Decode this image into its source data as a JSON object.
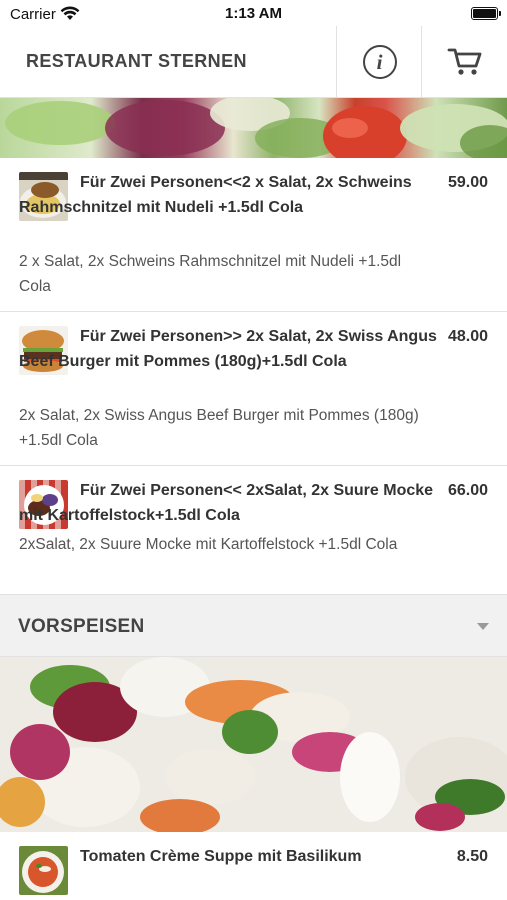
{
  "status_bar": {
    "carrier": "Carrier",
    "time": "1:13 AM"
  },
  "header": {
    "title": "RESTAURANT STERNEN",
    "info_icon": "info-circle-icon",
    "cart_icon": "shopping-cart-icon"
  },
  "items": [
    {
      "title": "Für Zwei Personen<<2 x Salat, 2x Schweins Rahmschnitzel mit Nudeli +1.5dl Cola",
      "price": "59.00",
      "description": "2 x Salat, 2x Schweins Rahmschnitzel mit Nudeli +1.5dl Cola"
    },
    {
      "title": "Für Zwei Personen>> 2x Salat, 2x Swiss Angus Beef Burger mit Pommes (180g)+1.5dl Cola",
      "price": "48.00",
      "description": "2x Salat, 2x Swiss Angus Beef Burger mit Pommes (180g) +1.5dl Cola"
    },
    {
      "title": "Für Zwei Personen<< 2xSalat, 2x Suure Mocke mit Kartoffelstock+1.5dl Cola",
      "price": "66.00",
      "description": "2xSalat, 2x Suure Mocke mit Kartoffelstock +1.5dl Cola"
    }
  ],
  "section": {
    "title": "VORSPEISEN",
    "caret_icon": "caret-down-icon"
  },
  "next_item": {
    "title": "Tomaten Crème Suppe mit Basilikum",
    "price": "8.50"
  },
  "colors": {
    "text": "#333333",
    "divider": "#e2e2e2",
    "section_bg": "#f1f1f1"
  }
}
